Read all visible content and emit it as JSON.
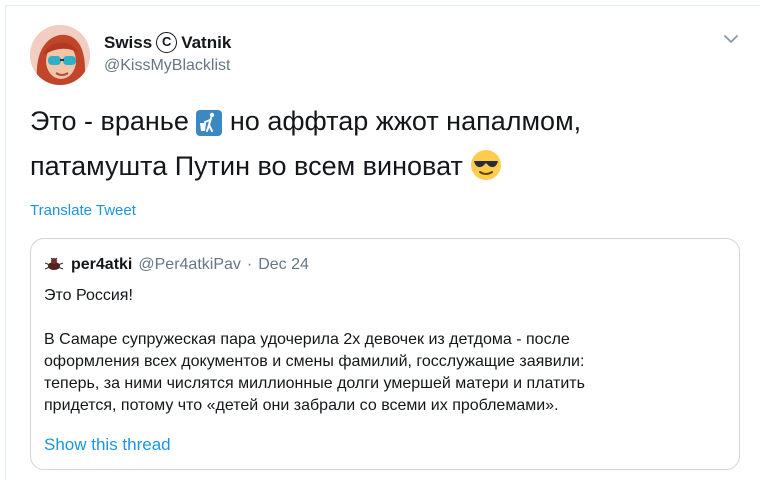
{
  "author": {
    "display_name_left": "Swiss",
    "display_name_symbol": "©",
    "display_name_right": "Vatnik",
    "handle": "@KissMyBlacklist"
  },
  "tweet": {
    "text_part1": "Это - вранье",
    "text_part2": "но аффтар жжот напалмом,",
    "text_line2": "патамушта Путин во всем виноват",
    "emoji_1": "litter-in-bin-sign",
    "emoji_2": "smiling-face-with-sunglasses"
  },
  "translate_label": "Translate Tweet",
  "quoted": {
    "name": "per4atki",
    "handle": "@Per4atkiPav",
    "separator": "·",
    "date": "Dec 24",
    "line1": "Это Россия!",
    "paragraph": [
      "В Самаре супружеская пара удочерила 2х девочек из детдома - после",
      "оформления всех документов и смены фамилий, госслужащие заявили:",
      "теперь, за ними числятся миллионные долги умершей матери и платить",
      "придется, потому что «детей они забрали со всеми их проблемами»."
    ],
    "show_thread": "Show this thread"
  },
  "colors": {
    "link": "#1b95e0",
    "secondary_text": "#657786",
    "border": "#ccd6dd"
  }
}
